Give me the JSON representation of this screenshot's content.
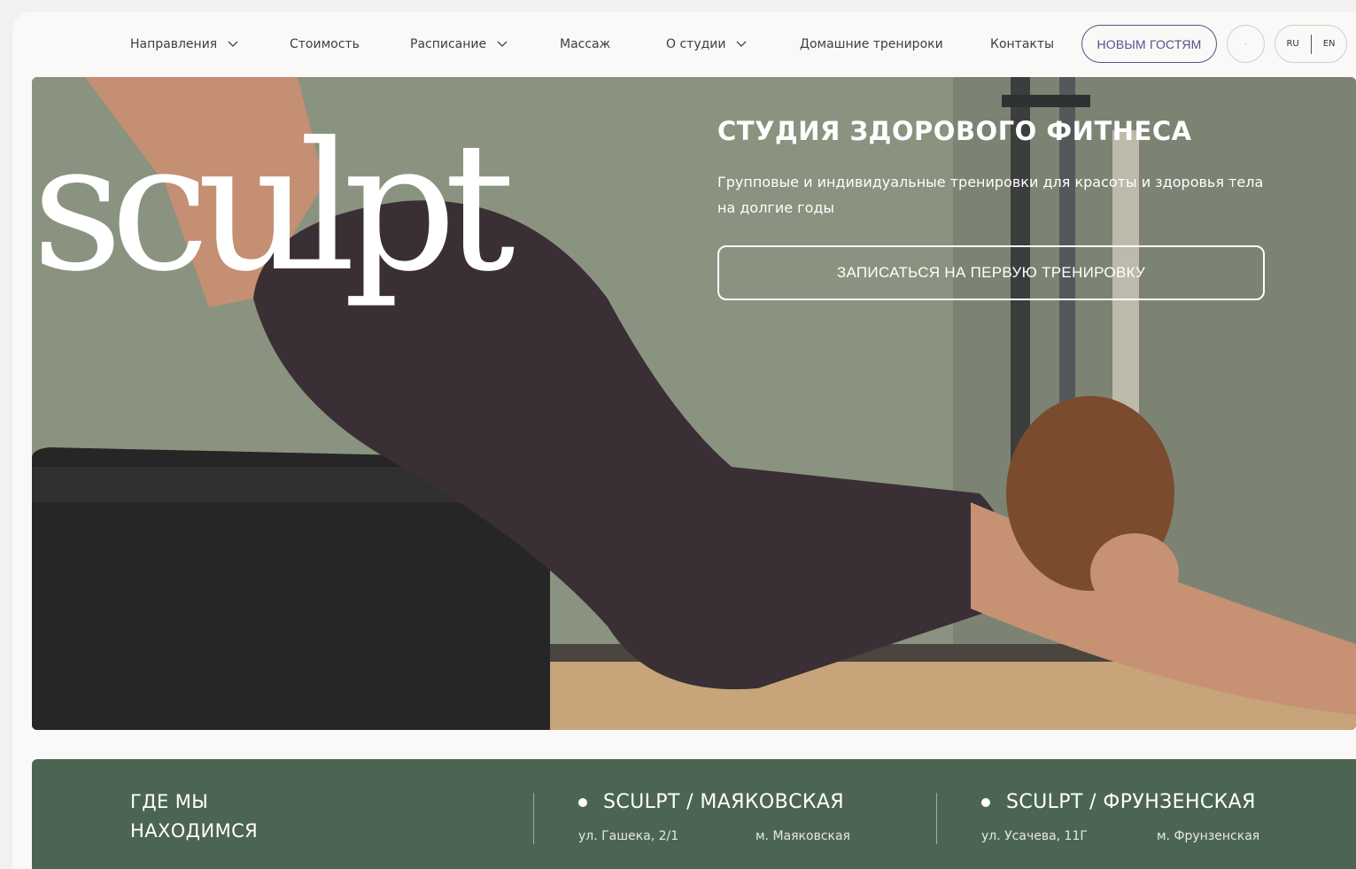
{
  "nav": {
    "items": [
      {
        "label": "Направления",
        "dropdown": true
      },
      {
        "label": "Стоимость",
        "dropdown": false
      },
      {
        "label": "Расписание",
        "dropdown": true
      },
      {
        "label": "Массаж",
        "dropdown": false
      },
      {
        "label": "О студии",
        "dropdown": true
      },
      {
        "label": "Домашние тренироки",
        "dropdown": false
      },
      {
        "label": "Контакты",
        "dropdown": false
      }
    ],
    "new_guests_label": "НОВЫМ ГОСТЯМ",
    "circle_button_label": "-",
    "lang_ru": "RU",
    "lang_en": "EN"
  },
  "hero": {
    "logo": "sculpt",
    "title": "СТУДИЯ ЗДОРОВОГО ФИТНЕСА",
    "subtitle": "Групповые и индивидуальные тренировки для красоты и здоровья тела на долгие годы",
    "cta_label": "ЗАПИСАТЬСЯ НА ПЕРВУЮ ТРЕНИРОВКУ"
  },
  "locations": {
    "heading_line1": "ГДЕ МЫ",
    "heading_line2": "НАХОДИМСЯ",
    "studios": [
      {
        "name": "SCULPT / МАЯКОВСКАЯ",
        "address": "ул. Гашека, 2/1",
        "metro": "м. Маяковская"
      },
      {
        "name": "SCULPT / ФРУНЗЕНСКАЯ",
        "address": "ул. Усачева, 11Г",
        "metro": "м. Фрунзенская"
      }
    ]
  },
  "colors": {
    "accent": "#5b4e8c",
    "locations_bg": "#4c6552",
    "page_bg": "#faf9f7"
  }
}
